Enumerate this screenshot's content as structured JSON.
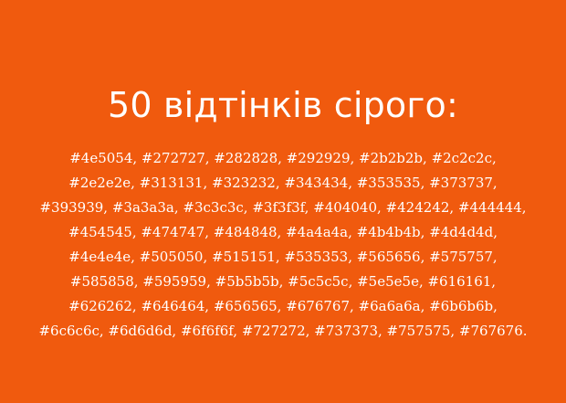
{
  "slide": {
    "title": "50 відтінків сірого:",
    "body": "#4e5054, #272727, #282828, #292929, #2b2b2b, #2c2c2c, #2e2e2e, #313131, #323232, #343434, #353535, #373737, #393939, #3a3a3a, #3c3c3c, #3f3f3f, #404040, #424242, #444444, #454545, #474747, #484848, #4a4a4a, #4b4b4b, #4d4d4d, #4e4e4e, #505050, #515151, #535353, #565656, #575757, #585858, #595959, #5b5b5b, #5c5c5c, #5e5e5e, #616161, #626262, #646464, #656565, #676767, #6a6a6a, #6b6b6b, #6c6c6c, #6d6d6d, #6f6f6f, #727272, #737373, #757575, #767676."
  },
  "colors": {
    "background": "#f05a0e",
    "text": "#ffffff"
  }
}
